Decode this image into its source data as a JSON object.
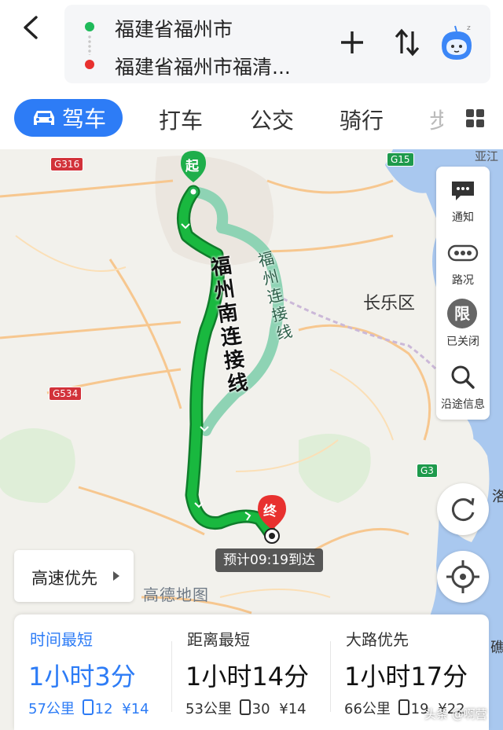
{
  "header": {
    "origin": "福建省福州市",
    "destination": "福建省福州市福清...",
    "origin_color": "#1fba5a",
    "destination_color": "#e8312f"
  },
  "tabs": [
    {
      "label": "驾车",
      "active": true
    },
    {
      "label": "打车"
    },
    {
      "label": "公交"
    },
    {
      "label": "骑行"
    },
    {
      "label": "步"
    }
  ],
  "map": {
    "place_label": "长乐区",
    "roads": [
      "G316",
      "G15",
      "G534",
      "G3"
    ],
    "route_main_label": "福州南连接线",
    "route_alt_label": "福州连接线",
    "start_marker": "起",
    "end_marker": "终",
    "edge_labels": [
      "亚江",
      "洛",
      "礁"
    ],
    "eta": "预计09:19到达",
    "watermark": "高德地图",
    "route_color": "#19a33a",
    "alt_route_color": "#8ed3b4"
  },
  "side_panel": [
    {
      "label": "通知",
      "icon": "message-icon"
    },
    {
      "label": "路况",
      "icon": "traffic-icon"
    },
    {
      "label": "已关闭",
      "icon": "restriction-icon",
      "glyph": "限"
    },
    {
      "label": "沿途信息",
      "icon": "search-icon"
    }
  ],
  "preference": {
    "label": "高速优先"
  },
  "route_options": [
    {
      "name": "时间最短",
      "time": "1小时3分",
      "distance": "57公里",
      "lights": "12",
      "toll": "¥14",
      "active": true
    },
    {
      "name": "距离最短",
      "time": "1小时14分",
      "distance": "53公里",
      "lights": "30",
      "toll": "¥14"
    },
    {
      "name": "大路优先",
      "time": "1小时17分",
      "distance": "66公里",
      "lights": "19",
      "toll": "¥22"
    }
  ],
  "credit": "头条 @啊营",
  "accent_color": "#2d7cf6"
}
